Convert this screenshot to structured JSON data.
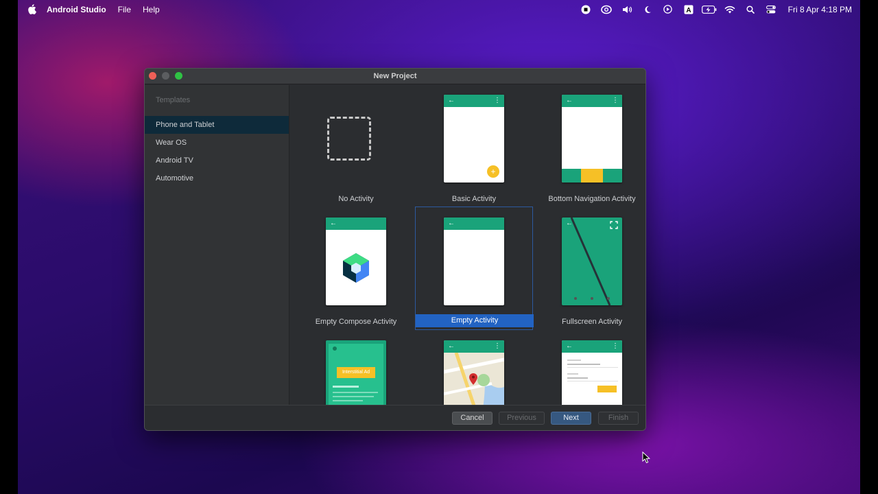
{
  "menubar": {
    "app_name": "Android Studio",
    "menus": [
      "File",
      "Help"
    ],
    "clock": "Fri 8 Apr  4:18 PM",
    "input_source": "A"
  },
  "window": {
    "title": "New Project"
  },
  "sidebar": {
    "header": "Templates",
    "items": [
      {
        "label": "Phone and Tablet",
        "selected": true
      },
      {
        "label": "Wear OS",
        "selected": false
      },
      {
        "label": "Android TV",
        "selected": false
      },
      {
        "label": "Automotive",
        "selected": false
      }
    ]
  },
  "templates": [
    {
      "label": "No Activity"
    },
    {
      "label": "Basic Activity"
    },
    {
      "label": "Bottom Navigation Activity"
    },
    {
      "label": "Empty Compose Activity"
    },
    {
      "label": "Empty Activity",
      "selected": true
    },
    {
      "label": "Fullscreen Activity"
    },
    {
      "label": "",
      "ad_label": "Interstitial Ad"
    },
    {
      "label": ""
    },
    {
      "label": ""
    }
  ],
  "footer": {
    "cancel": "Cancel",
    "previous": "Previous",
    "next": "Next",
    "finish": "Finish"
  },
  "colors": {
    "accent_green": "#1aa37a",
    "selection_blue": "#2263c3",
    "fab_yellow": "#f6c026"
  }
}
